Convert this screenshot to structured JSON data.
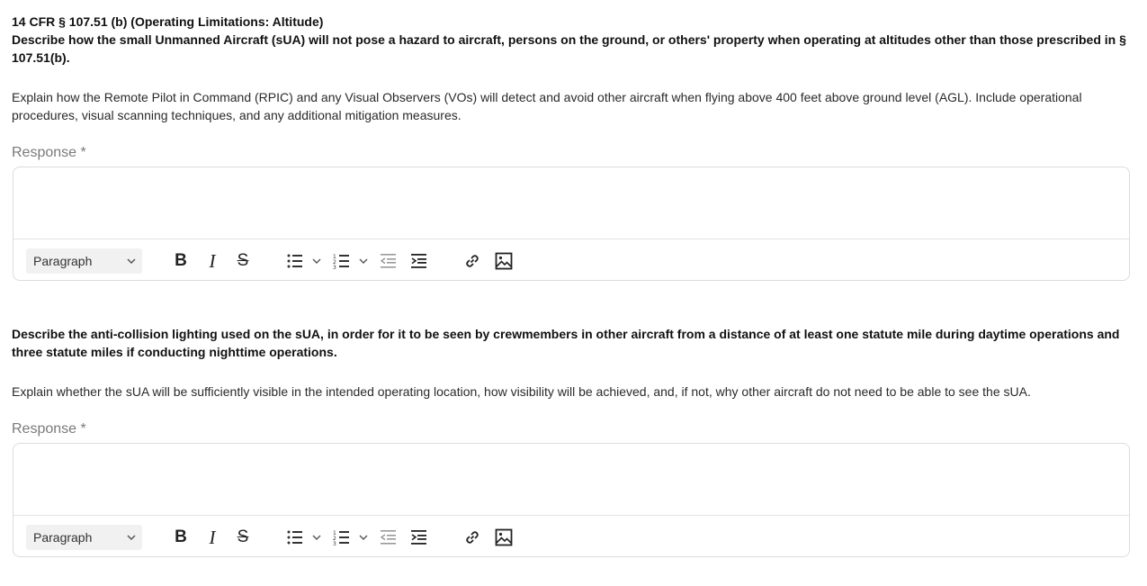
{
  "sections": [
    {
      "regulation": "14 CFR § 107.51 (b) (Operating Limitations: Altitude)",
      "question": "Describe how the small Unmanned Aircraft (sUA) will not pose a hazard to aircraft, persons on the ground, or others' property when operating at altitudes other than those prescribed in § 107.51(b).",
      "guidance": "Explain how the Remote Pilot in Command (RPIC) and any Visual Observers (VOs) will detect and avoid other aircraft when flying above 400 feet above ground level (AGL). Include operational procedures, visual scanning techniques, and any additional mitigation measures.",
      "response_label": "Response *",
      "format_select": "Paragraph"
    },
    {
      "question": "Describe the anti-collision lighting used on the sUA, in order for it to be seen by crewmembers in other aircraft from a distance of at least one statute mile during daytime operations and three statute miles if conducting nighttime operations.",
      "guidance": "Explain whether the sUA will be sufficiently visible in the intended operating location, how visibility will be achieved, and, if not, why other aircraft do not need to be able to see the sUA.",
      "response_label": "Response *",
      "format_select": "Paragraph"
    }
  ],
  "toolbar": {
    "bold_label": "B",
    "italic_label": "I",
    "strike_label": "S"
  },
  "icons": [
    "chevron-down-icon",
    "bold-icon",
    "italic-icon",
    "strikethrough-icon",
    "bulleted-list-icon",
    "numbered-list-icon",
    "outdent-icon",
    "indent-icon",
    "link-icon",
    "image-icon"
  ]
}
